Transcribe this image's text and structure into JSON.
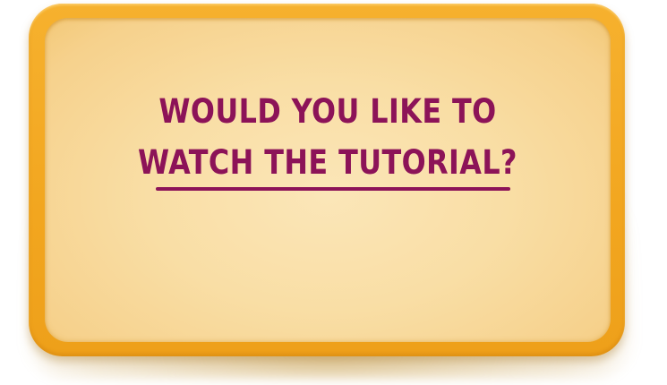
{
  "dialog": {
    "title_line_1": "WOULD YOU LIKE TO",
    "title_line_2": "WATCH THE TUTORIAL?"
  },
  "colors": {
    "frame": "#f2a61f",
    "panel": "#f9dea5",
    "title_text": "#8c1358"
  }
}
